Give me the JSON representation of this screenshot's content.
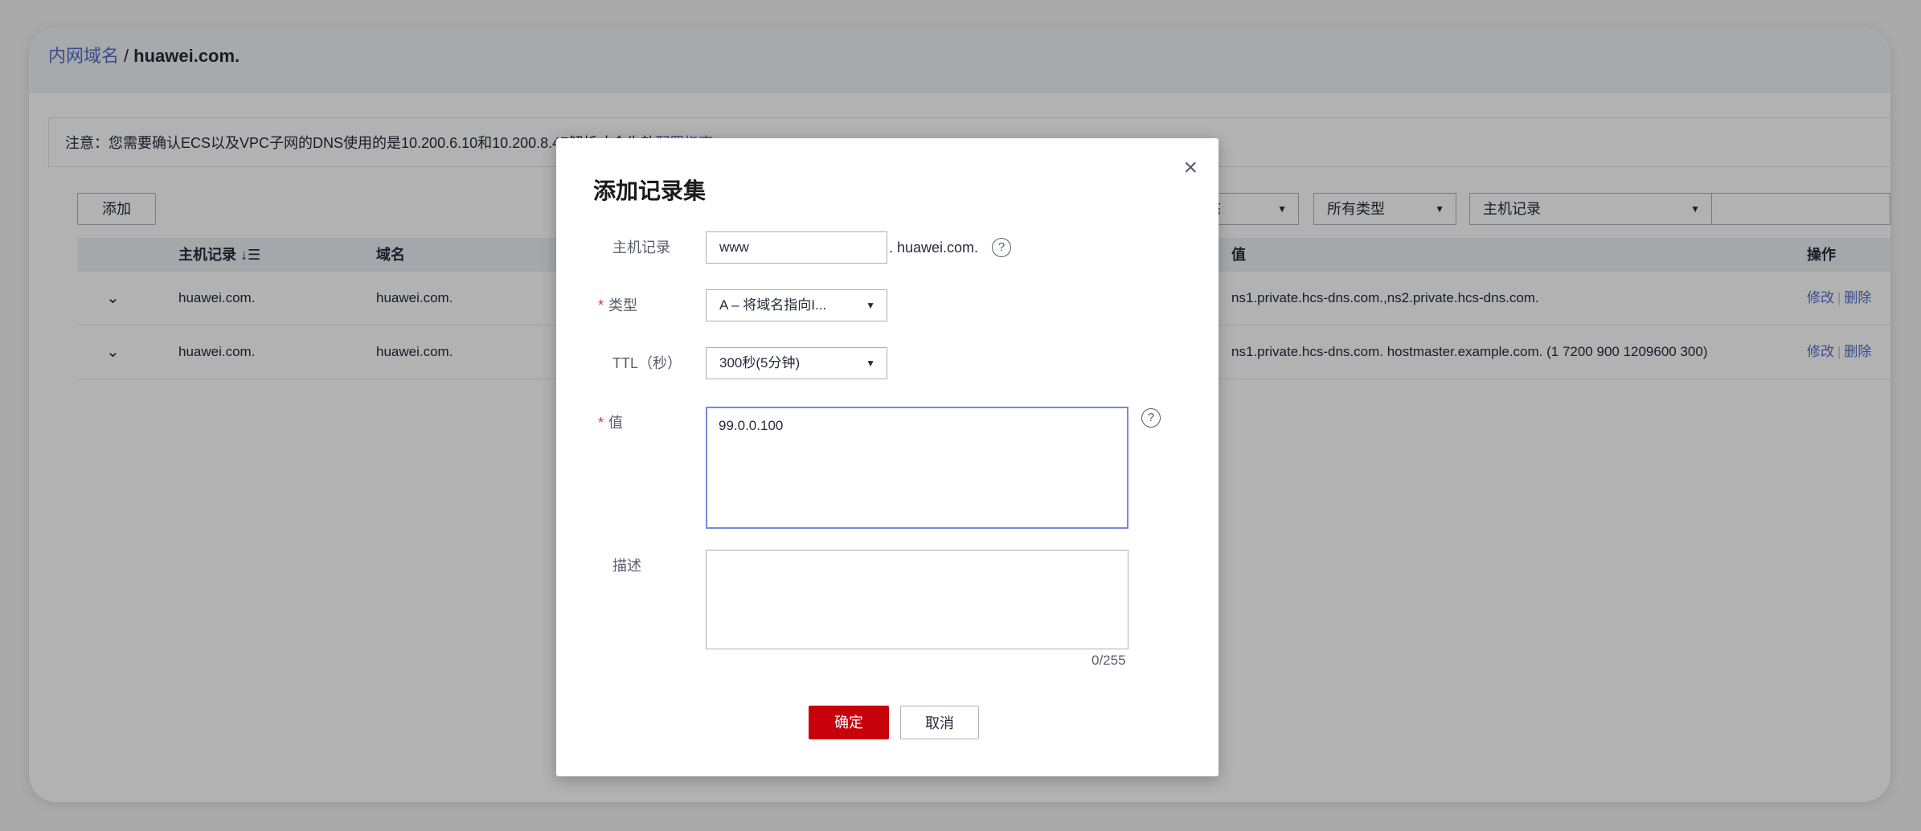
{
  "breadcrumb": {
    "parent": "内网域名",
    "separator": "/",
    "current": "huawei.com."
  },
  "notice": {
    "text": "注意：您需要确认ECS以及VPC子网的DNS使用的是10.200.6.10和10.200.8.47解析才会生效",
    "link": "配置指南"
  },
  "toolbar": {
    "add_label": "添加",
    "status_filter": "状态",
    "type_filter": "所有类型",
    "field_filter": "主机记录"
  },
  "table": {
    "headers": {
      "host": "主机记录",
      "domain": "域名",
      "value": "值",
      "ops": "操作"
    },
    "rows": [
      {
        "host": "huawei.com.",
        "domain": "huawei.com.",
        "value": "ns1.private.hcs-dns.com.,ns2.private.hcs-dns.com.",
        "edit": "修改",
        "delete": "删除"
      },
      {
        "host": "huawei.com.",
        "domain": "huawei.com.",
        "value": "ns1.private.hcs-dns.com. hostmaster.example.com. (1 7200 900 1209600 300)",
        "edit": "修改",
        "delete": "删除"
      }
    ]
  },
  "modal": {
    "title": "添加记录集",
    "close": "×",
    "host_label": "主机记录",
    "host_value": "www",
    "host_suffix": ". huawei.com.",
    "type_label": "类型",
    "type_value": "A – 将域名指向I...",
    "ttl_label": "TTL（秒）",
    "ttl_value": "300秒(5分钟)",
    "value_label": "值",
    "value_text": "99.0.0.100",
    "desc_label": "描述",
    "desc_counter": "0/255",
    "confirm": "确定",
    "cancel": "取消"
  }
}
